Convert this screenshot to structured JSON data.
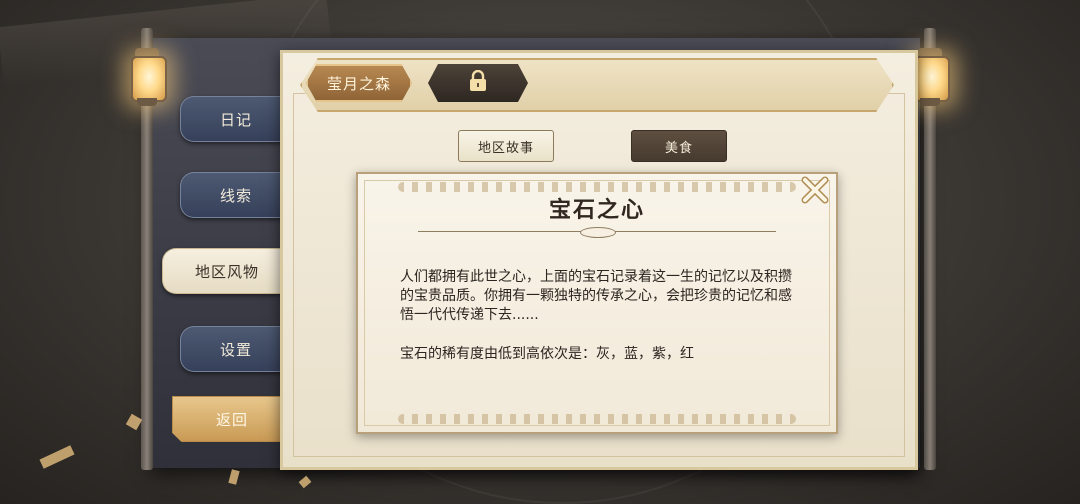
{
  "side_menu": {
    "diary": "日记",
    "clues": "线索",
    "regional": "地区风物",
    "settings": "设置",
    "back": "返回"
  },
  "header": {
    "region_tab": "莹月之森",
    "locked_tab_icon": "lock-icon"
  },
  "subtabs": {
    "story": "地区故事",
    "food": "美食"
  },
  "card": {
    "title": "宝石之心",
    "paragraph1": "人们都拥有此世之心，上面的宝石记录着这一生的记忆以及积攒的宝贵品质。你拥有一颗独特的传承之心，会把珍贵的记忆和感悟一代代传递下去......",
    "paragraph2": "宝石的稀有度由低到高依次是：灰，蓝，紫，红",
    "close_icon": "close-icon"
  },
  "colors": {
    "accent_gold": "#b98a52",
    "tab_blue": "#3e4a63",
    "paper": "#f4eee0",
    "dark_brown": "#463a2f"
  }
}
